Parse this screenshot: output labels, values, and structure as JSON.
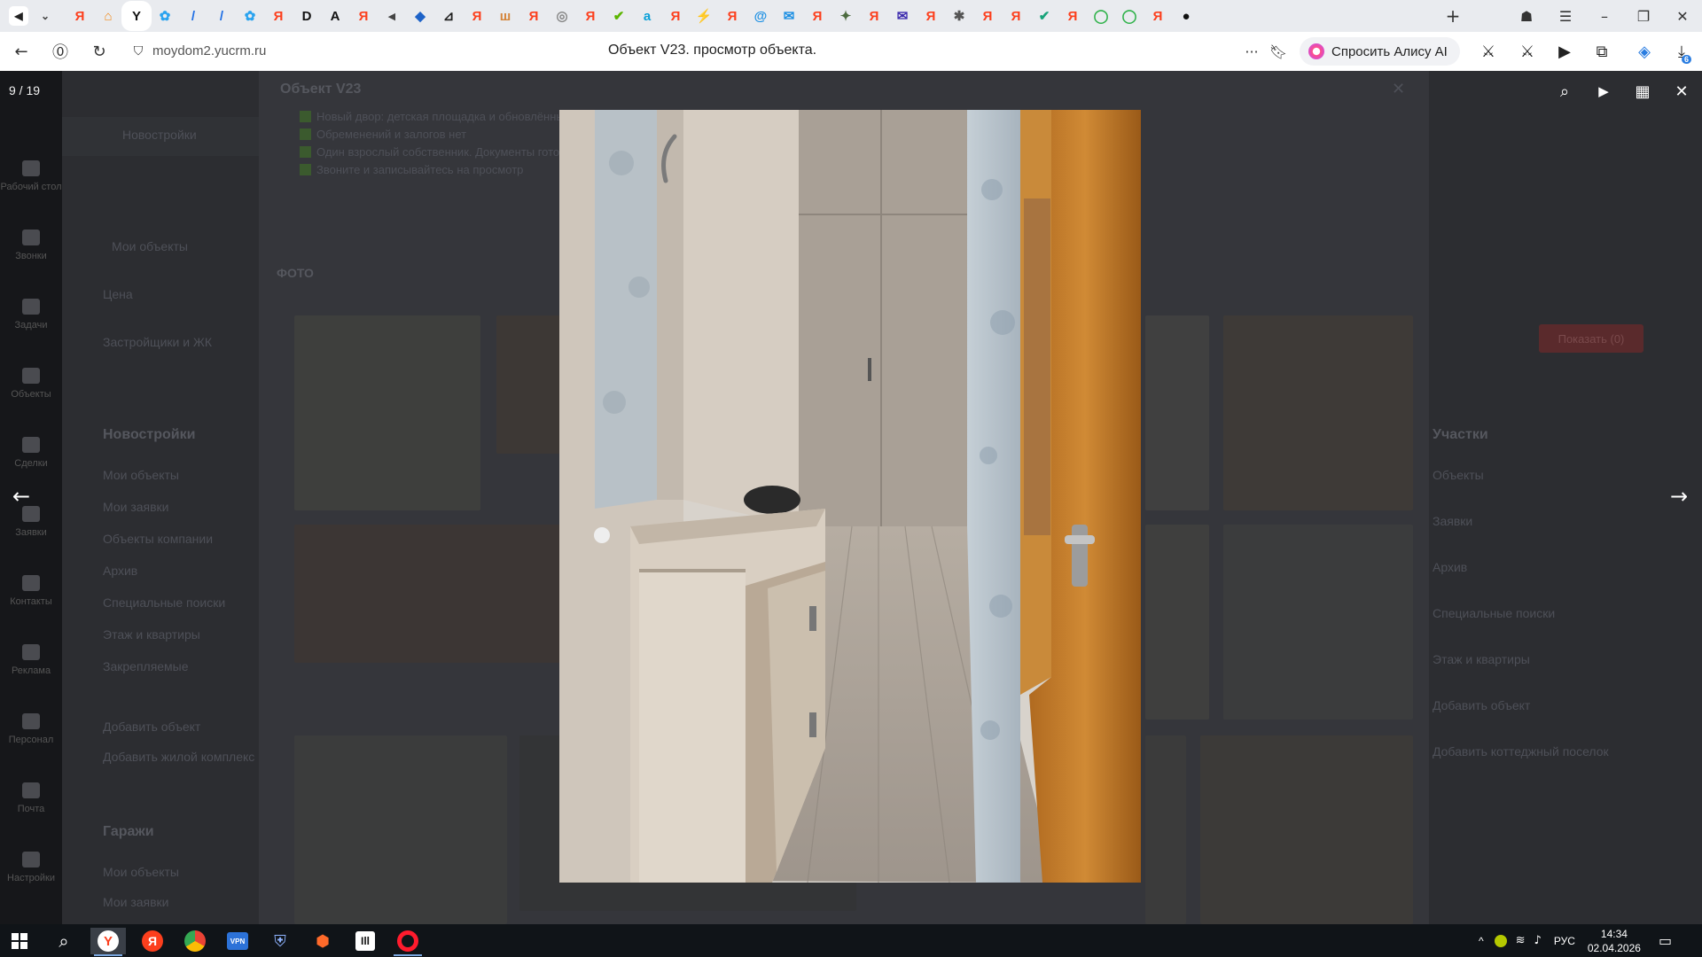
{
  "browser": {
    "url": "moydom2.yucrm.ru",
    "page_title": "Объект V23. просмотр объекта.",
    "alice_button": "Спросить Алису AI",
    "more": "···",
    "extension_badge": "6"
  },
  "tabs": [
    {
      "glyph": "Я",
      "color": "#fc3f1d"
    },
    {
      "glyph": "⌂",
      "color": "#f28b1c"
    },
    {
      "glyph": "Y",
      "color": "#111111",
      "active": true
    },
    {
      "glyph": "✿",
      "color": "#2aa3ef"
    },
    {
      "glyph": "/",
      "color": "#1f6fe5"
    },
    {
      "glyph": "/",
      "color": "#1f6fe5"
    },
    {
      "glyph": "✿",
      "color": "#2aa3ef"
    },
    {
      "glyph": "Я",
      "color": "#fc3f1d"
    },
    {
      "glyph": "D",
      "color": "#111111"
    },
    {
      "glyph": "A",
      "color": "#111111"
    },
    {
      "glyph": "Я",
      "color": "#fc3f1d"
    },
    {
      "glyph": "◂",
      "color": "#444444"
    },
    {
      "glyph": "◆",
      "color": "#1e63c8"
    },
    {
      "glyph": "⊿",
      "color": "#222222"
    },
    {
      "glyph": "Я",
      "color": "#fc3f1d"
    },
    {
      "glyph": "ш",
      "color": "#d4843a"
    },
    {
      "glyph": "Я",
      "color": "#fc3f1d"
    },
    {
      "glyph": "◎",
      "color": "#888888"
    },
    {
      "glyph": "Я",
      "color": "#fc3f1d"
    },
    {
      "glyph": "✔",
      "color": "#5bb500"
    },
    {
      "glyph": "a",
      "color": "#0aa0d8"
    },
    {
      "glyph": "Я",
      "color": "#fc3f1d"
    },
    {
      "glyph": "⚡",
      "color": "#c62828"
    },
    {
      "glyph": "Я",
      "color": "#fc3f1d"
    },
    {
      "glyph": "@",
      "color": "#1b8fe3"
    },
    {
      "glyph": "✉",
      "color": "#1b8fe3"
    },
    {
      "glyph": "Я",
      "color": "#fc3f1d"
    },
    {
      "glyph": "✦",
      "color": "#4c6b3f"
    },
    {
      "glyph": "Я",
      "color": "#fc3f1d"
    },
    {
      "glyph": "✉",
      "color": "#3d2cae"
    },
    {
      "glyph": "Я",
      "color": "#fc3f1d"
    },
    {
      "glyph": "✱",
      "color": "#555555"
    },
    {
      "glyph": "Я",
      "color": "#fc3f1d"
    },
    {
      "glyph": "Я",
      "color": "#fc3f1d"
    },
    {
      "glyph": "✔",
      "color": "#18a37a"
    },
    {
      "glyph": "Я",
      "color": "#fc3f1d"
    },
    {
      "glyph": "◯",
      "color": "#2fb24a"
    },
    {
      "glyph": "◯",
      "color": "#2fb24a"
    },
    {
      "glyph": "Я",
      "color": "#fc3f1d"
    },
    {
      "glyph": "●",
      "color": "#111111"
    }
  ],
  "viewer": {
    "counter": "9 / 19"
  },
  "background_page": {
    "modal_title": "Объект V23",
    "checklist": [
      "Новый двор: детская площадка и обновлённые лавочки",
      "Обременений и залогов нет",
      "Один взрослый собственник. Документы готовы",
      "Звоните и записывайтесь на просмотр"
    ],
    "photo_section": "ФОТО",
    "left_nav": [
      "Рабочий стол",
      "Звонки",
      "Задачи",
      "Объекты",
      "Сделки",
      "Заявки",
      "Контакты",
      "Реклама",
      "Персонал",
      "Почта",
      "Настройки"
    ],
    "sidebar": {
      "breadcrumb": "Новостройки",
      "filters": [
        "Мои объекты",
        "Цена",
        "Застройщики и ЖК"
      ],
      "section1_title": "Новостройки",
      "section1_items": [
        "Мои объекты",
        "Мои заявки",
        "Объекты компании",
        "Архив",
        "Специальные поиски",
        "Этаж и квартиры",
        "Закрепляемые"
      ],
      "add_object": "Добавить объект",
      "add_residential": "Добавить жилой комплекс",
      "section2_title": "Гаражи",
      "section2_items": [
        "Мои объекты",
        "Мои заявки"
      ]
    },
    "right_panel": {
      "show_button": "Показать (0)",
      "section_title": "Участки",
      "items": [
        "Объекты",
        "Заявки",
        "Архив",
        "Специальные поиски",
        "Этаж и квартиры",
        "Добавить объект",
        "Добавить коттеджный поселок"
      ]
    }
  },
  "taskbar": {
    "lang": "РУС",
    "time": "14:34",
    "date": "02.04.2026"
  },
  "colors": {
    "tabbar_bg": "#e9ebef",
    "overlay": "#2a2b30",
    "yandex_red": "#fc3f1d"
  }
}
